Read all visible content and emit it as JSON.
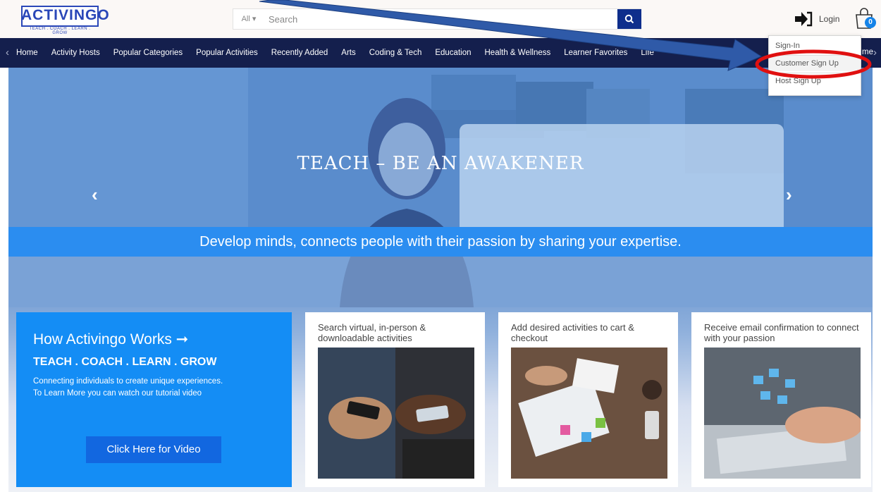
{
  "header": {
    "logo": {
      "name": "ACTIVINGO",
      "tagline": "TEACH . COACH . LEARN . GROW"
    },
    "search": {
      "category": "All",
      "placeholder": "Search"
    },
    "login_label": "Login",
    "cart_count": "0"
  },
  "nav": {
    "items": [
      "Home",
      "Activity Hosts",
      "Popular Categories",
      "Popular Activities",
      "Recently Added",
      "Arts",
      "Coding & Tech",
      "Education",
      "Health & Wellness",
      "Learner Favorites",
      "Life",
      "me"
    ]
  },
  "dropdown": {
    "items": [
      "Sign-In",
      "Customer Sign Up",
      "Host Sign Up"
    ],
    "highlighted": "Customer Sign Up"
  },
  "hero": {
    "title": "TEACH – BE AN AWAKENER",
    "banner": "Develop minds, connects people with their passion by sharing your expertise."
  },
  "how": {
    "title": "How Activingo Works ➞",
    "subtitle": "TEACH . COACH . LEARN . GROW",
    "desc_line1": "Connecting individuals to create unique experiences.",
    "desc_line2": "To Learn More you can watch our tutorial video",
    "button": "Click Here for Video"
  },
  "cards": [
    {
      "text": "Search virtual, in-person & downloadable activities"
    },
    {
      "text": "Add desired activities to cart & checkout"
    },
    {
      "text": "Receive email confirmation to connect with your passion"
    }
  ],
  "icons": {
    "search": "search-icon",
    "login": "login-arrow-icon",
    "cart": "shopping-bag-icon",
    "carousel_prev": "chevron-left-icon",
    "carousel_next": "chevron-right-icon"
  },
  "colors": {
    "brand_blue": "#2a47b8",
    "nav_bg": "#141f4d",
    "banner_blue": "#2b8df0",
    "how_blue": "#148df5",
    "button_blue": "#1267e0",
    "annotation_arrow": "#2f5aa8",
    "annotation_circle": "#e01010"
  }
}
